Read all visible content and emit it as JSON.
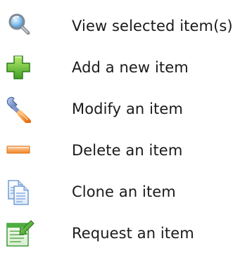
{
  "legend": {
    "items": [
      {
        "icon": "magnifier-icon",
        "label": "View selected item(s)"
      },
      {
        "icon": "plus-icon",
        "label": "Add a new item"
      },
      {
        "icon": "wrench-icon",
        "label": "Modify an item"
      },
      {
        "icon": "minus-icon",
        "label": "Delete an item"
      },
      {
        "icon": "clone-icon",
        "label": "Clone an item"
      },
      {
        "icon": "request-icon",
        "label": "Request an item"
      }
    ]
  },
  "colors": {
    "magnifier_lens": "#6aaee0",
    "plus_green": "#4caf2e",
    "wrench_blue": "#4a6fb5",
    "wrench_handle": "#f08a2a",
    "minus_orange": "#f0872a",
    "clone_blue": "#5b8fd1",
    "request_green": "#3f9a3a"
  }
}
